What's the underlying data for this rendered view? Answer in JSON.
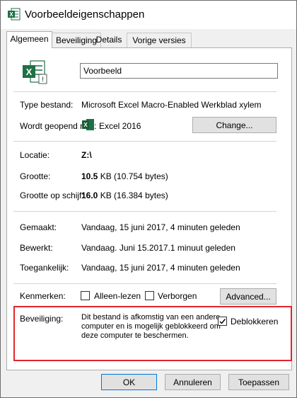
{
  "window": {
    "title": "Voorbeeldeigenschappen"
  },
  "tabs": [
    {
      "label": "Algemeen"
    },
    {
      "label": "Beveiliging"
    },
    {
      "label": "Details"
    },
    {
      "label": "Vorige versies"
    }
  ],
  "general": {
    "filename": "Voorbeeld",
    "type_label": "Type bestand:",
    "type_value": "Microsoft Excel Macro-Enabled Werkblad xylem",
    "opens_label": "Wordt geopend met:",
    "opens_value": "Excel 2016",
    "change_button": "Change...",
    "location_label": "Locatie:",
    "location_value": "Z:\\",
    "size_label": "Grootte:",
    "size_value_bold": "10.5",
    "size_value_rest": " KB (10.754 bytes)",
    "disk_label": "Grootte op schijf:",
    "disk_value_bold": "16.0",
    "disk_value_rest": " KB (16.384 bytes)",
    "created_label": "Gemaakt:",
    "created_value": "Vandaag, 15 juni 2017, 4 minuten geleden",
    "modified_label": "Bewerkt:",
    "modified_value": "Vandaag. Juni 15.2017.1 minuut geleden",
    "accessed_label": "Toegankelijk:",
    "accessed_value": "Vandaag, 15 juni 2017, 4 minuten geleden",
    "attributes_label": "Kenmerken:",
    "readonly_label": "Alleen-lezen",
    "hidden_label": "Verborgen",
    "advanced_button": "Advanced...",
    "security_label": "Beveiliging:",
    "security_text": "Dit bestand is afkomstig van een andere computer en is mogelijk geblokkeerd om deze computer te beschermen.",
    "unblock_label": "Deblokkeren",
    "unblock_checked": true
  },
  "footer": {
    "ok": "OK",
    "cancel": "Annuleren",
    "apply": "Toepassen"
  },
  "colors": {
    "excel_green": "#1e7145",
    "highlight": "#e0262c",
    "accent": "#0078d7"
  }
}
